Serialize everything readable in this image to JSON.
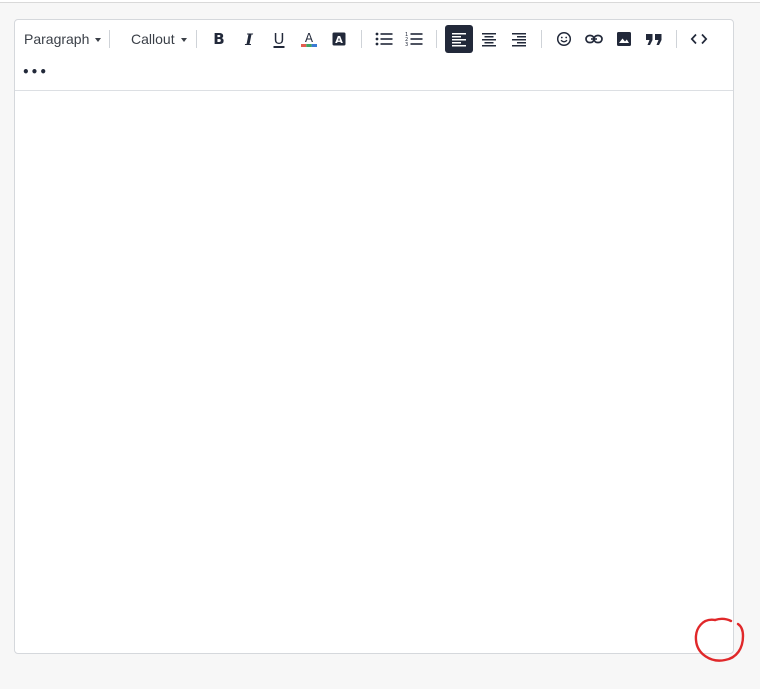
{
  "toolbar": {
    "block_format": {
      "label": "Paragraph"
    },
    "block_style": {
      "label": "Callout"
    },
    "more_label": "•••"
  },
  "icons": {
    "bold": "B",
    "italic": "I",
    "underline": "U",
    "text_color": "A",
    "highlight": "A"
  },
  "colors": {
    "accent": "#22293a",
    "annotation": "#e0282a"
  }
}
